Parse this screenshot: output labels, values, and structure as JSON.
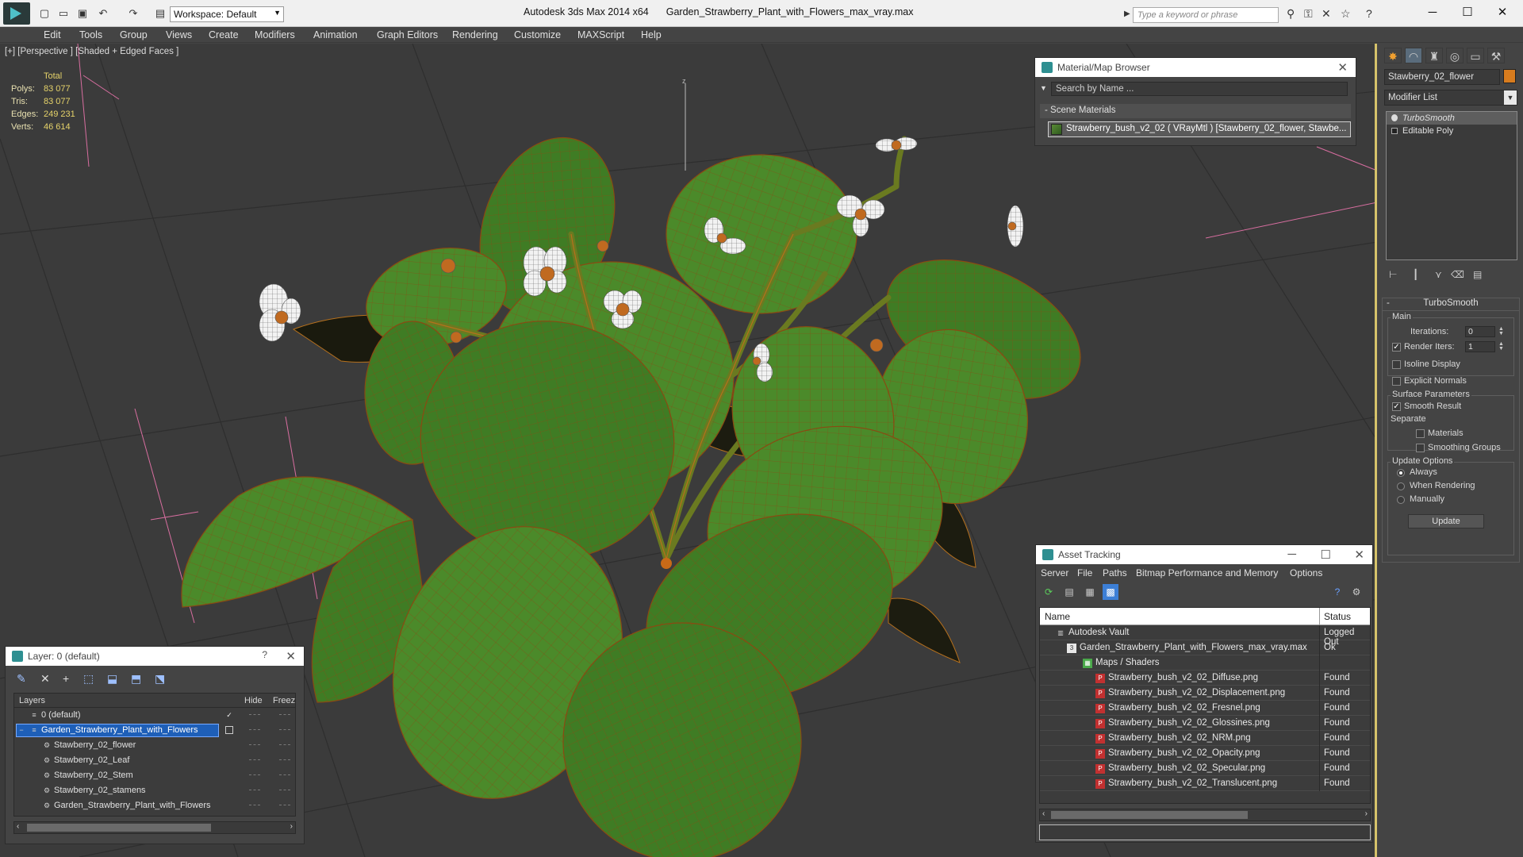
{
  "window": {
    "app": "Autodesk 3ds Max  2014 x64",
    "file": "Garden_Strawberry_Plant_with_Flowers_max_vray.max",
    "workspace": "Workspace: Default",
    "search_placeholder": "Type a keyword or phrase"
  },
  "menu": [
    "Edit",
    "Tools",
    "Group",
    "Views",
    "Create",
    "Modifiers",
    "Animation",
    "Graph Editors",
    "Rendering",
    "Customize",
    "MAXScript",
    "Help"
  ],
  "viewport": {
    "label": "[+] [Perspective ] [Shaded + Edged Faces ]",
    "stats": {
      "header": "Total",
      "rows": [
        {
          "label": "Polys:",
          "value": "83 077"
        },
        {
          "label": "Tris:",
          "value": "83 077"
        },
        {
          "label": "Edges:",
          "value": "249 231"
        },
        {
          "label": "Verts:",
          "value": "46 614"
        }
      ]
    },
    "axis_label": "z"
  },
  "material_browser": {
    "title": "Material/Map Browser",
    "search": "Search by Name ...",
    "section": "Scene Materials",
    "item": "Strawberry_bush_v2_02  ( VRayMtl ) [Stawberry_02_flower, Stawbe..."
  },
  "command_panel": {
    "object_name": "Stawberry_02_flower",
    "object_color": "#d87c1e",
    "modifier_list": "Modifier List",
    "stack": [
      {
        "label": "TurboSmooth",
        "selected": true
      },
      {
        "label": "Editable Poly",
        "selected": false
      }
    ],
    "turbosmooth": {
      "title": "TurboSmooth",
      "main_group": "Main",
      "iterations_label": "Iterations:",
      "iterations_value": "0",
      "render_iters_label": "Render Iters:",
      "render_iters_value": "1",
      "render_iters_checked": true,
      "isoline_label": "Isoline Display",
      "explicit_normals_label": "Explicit Normals",
      "surface_group": "Surface Parameters",
      "smooth_result_label": "Smooth Result",
      "separate_label": "Separate",
      "materials_label": "Materials",
      "smoothing_groups_label": "Smoothing Groups",
      "update_group": "Update Options",
      "always_label": "Always",
      "when_rendering_label": "When Rendering",
      "manually_label": "Manually",
      "update_button": "Update"
    }
  },
  "layer_panel": {
    "title": "Layer: 0 (default)",
    "col_layers": "Layers",
    "col_hide": "Hide",
    "col_freeze": "Freeze",
    "rows": [
      {
        "name": "0 (default)",
        "indent": 0,
        "selected": false,
        "current": true
      },
      {
        "name": "Garden_Strawberry_Plant_with_Flowers",
        "indent": 0,
        "selected": true,
        "current": false
      },
      {
        "name": "Stawberry_02_flower",
        "indent": 1,
        "selected": false,
        "current": false
      },
      {
        "name": "Stawberry_02_Leaf",
        "indent": 1,
        "selected": false,
        "current": false
      },
      {
        "name": "Stawberry_02_Stem",
        "indent": 1,
        "selected": false,
        "current": false
      },
      {
        "name": "Stawberry_02_stamens",
        "indent": 1,
        "selected": false,
        "current": false
      },
      {
        "name": "Garden_Strawberry_Plant_with_Flowers",
        "indent": 1,
        "selected": false,
        "current": false
      }
    ]
  },
  "asset_tracking": {
    "title": "Asset Tracking",
    "menu": [
      "Server",
      "File",
      "Paths",
      "Bitmap Performance and Memory",
      "Options"
    ],
    "col_name": "Name",
    "col_status": "Status",
    "rows": [
      {
        "name": "Autodesk Vault",
        "status": "Logged Out",
        "indent": 1,
        "icon": "vault"
      },
      {
        "name": "Garden_Strawberry_Plant_with_Flowers_max_vray.max",
        "status": "Ok",
        "indent": 2,
        "icon": "file"
      },
      {
        "name": "Maps / Shaders",
        "status": "",
        "indent": 3,
        "icon": "folder"
      },
      {
        "name": "Strawberry_bush_v2_02_Diffuse.png",
        "status": "Found",
        "indent": 4,
        "icon": "png"
      },
      {
        "name": "Strawberry_bush_v2_02_Displacement.png",
        "status": "Found",
        "indent": 4,
        "icon": "png"
      },
      {
        "name": "Strawberry_bush_v2_02_Fresnel.png",
        "status": "Found",
        "indent": 4,
        "icon": "png"
      },
      {
        "name": "Strawberry_bush_v2_02_Glossines.png",
        "status": "Found",
        "indent": 4,
        "icon": "png"
      },
      {
        "name": "Strawberry_bush_v2_02_NRM.png",
        "status": "Found",
        "indent": 4,
        "icon": "png"
      },
      {
        "name": "Strawberry_bush_v2_02_Opacity.png",
        "status": "Found",
        "indent": 4,
        "icon": "png"
      },
      {
        "name": "Strawberry_bush_v2_02_Specular.png",
        "status": "Found",
        "indent": 4,
        "icon": "png"
      },
      {
        "name": "Strawberry_bush_v2_02_Translucent.png",
        "status": "Found",
        "indent": 4,
        "icon": "png"
      }
    ]
  }
}
